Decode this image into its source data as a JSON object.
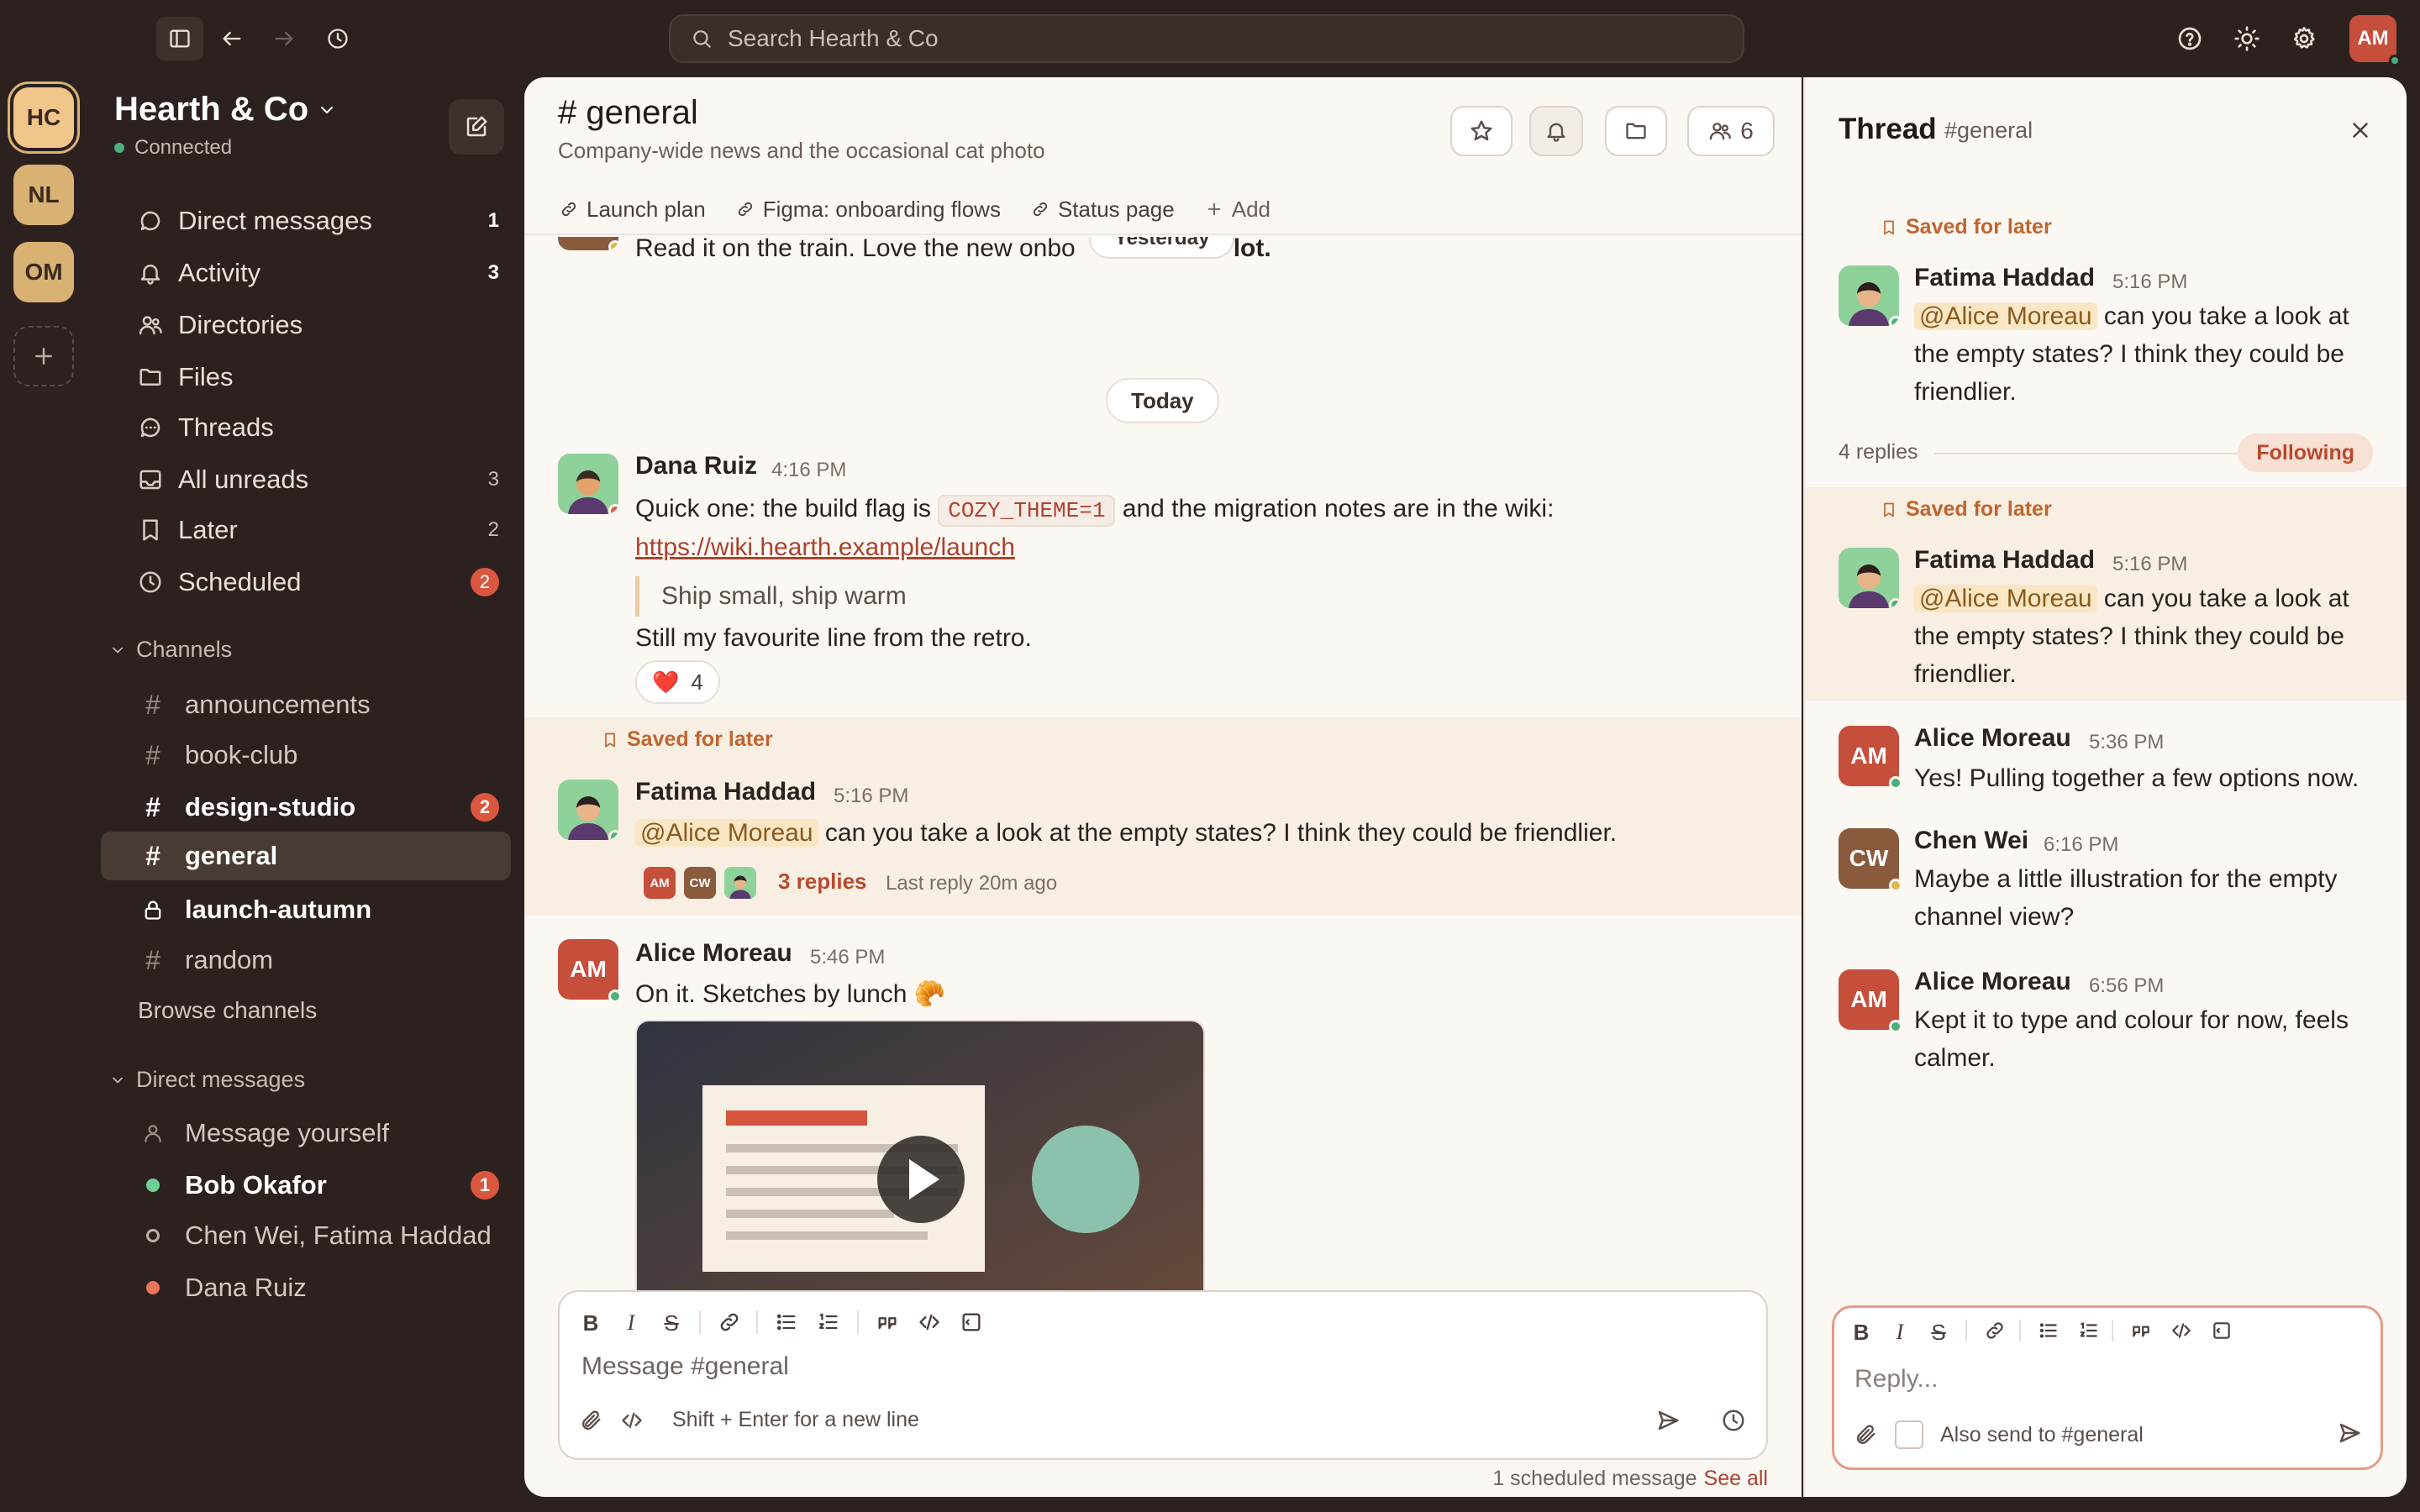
{
  "search": {
    "placeholder": "Search Hearth & Co"
  },
  "user": {
    "initials": "AM"
  },
  "workspaces": [
    {
      "initials": "HC",
      "color": "#f0c68a"
    },
    {
      "initials": "NL",
      "color": "#d9b172"
    },
    {
      "initials": "OM",
      "color": "#d9b172"
    }
  ],
  "sidebar": {
    "workspace_name": "Hearth & Co",
    "status": "Connected",
    "nav": [
      {
        "label": "Direct messages",
        "count": "1"
      },
      {
        "label": "Activity",
        "count": "3"
      },
      {
        "label": "Directories",
        "count": ""
      },
      {
        "label": "Files",
        "count": ""
      },
      {
        "label": "Threads",
        "count": ""
      },
      {
        "label": "All unreads",
        "count": "3"
      },
      {
        "label": "Later",
        "count": "2"
      },
      {
        "label": "Scheduled",
        "count": "2"
      }
    ],
    "channels_header": "Channels",
    "channels": [
      {
        "name": "announcements",
        "badge": ""
      },
      {
        "name": "book-club",
        "badge": ""
      },
      {
        "name": "design-studio",
        "badge": "2"
      },
      {
        "name": "general",
        "badge": ""
      },
      {
        "name": "launch-autumn",
        "badge": ""
      },
      {
        "name": "random",
        "badge": ""
      }
    ],
    "browse_channels": "Browse channels",
    "dms_header": "Direct messages",
    "dms": [
      {
        "name": "Message yourself",
        "badge": ""
      },
      {
        "name": "Bob Okafor",
        "badge": "1"
      },
      {
        "name": "Chen Wei, Fatima Haddad",
        "badge": ""
      },
      {
        "name": "Dana Ruiz",
        "badge": ""
      }
    ]
  },
  "channel": {
    "title": "# general",
    "description": "Company-wide news and the occasional cat photo",
    "member_count": "6",
    "bookmarks": [
      "Launch plan",
      "Figma: onboarding flows",
      "Status page",
      "Add"
    ]
  },
  "messages": {
    "prev_text_a": "Read it on the train. Love the new onbo",
    "prev_text_b": "lot.",
    "yesterday": "Yesterday",
    "today": "Today",
    "dana": {
      "name": "Dana Ruiz",
      "time": "4:16 PM",
      "text_a": "Quick one: the build flag is",
      "code": "COZY_THEME=1",
      "text_b": "and the migration notes are in the wiki:",
      "link": "https://wiki.hearth.example/launch",
      "quote": "Ship small, ship warm",
      "text_c": "Still my favourite line from the retro.",
      "reaction_emoji": "❤️",
      "reaction_count": "4"
    },
    "saved_label": "Saved for later",
    "fatima": {
      "name": "Fatima Haddad",
      "time": "5:16 PM",
      "mention": "@Alice Moreau",
      "text": "can you take a look at the empty states? I think they could be friendlier.",
      "replies": "3 replies",
      "last_reply": "Last reply 20m ago"
    },
    "alice": {
      "name": "Alice Moreau",
      "initials": "AM",
      "time": "5:46 PM",
      "text": "On it. Sketches by lunch 🥐"
    }
  },
  "composer": {
    "placeholder": "Message #general",
    "hint": "Shift + Enter for a new line",
    "scheduled": "1 scheduled message",
    "see_all": "See all"
  },
  "thread": {
    "title": "Thread",
    "channel": "#general",
    "saved_label": "Saved for later",
    "parent": {
      "name": "Fatima Haddad",
      "time": "5:16 PM",
      "mention": "@Alice Moreau",
      "text": "can you take a look at the empty states? I think they could be friendlier."
    },
    "replies_count": "4 replies",
    "following": "Following",
    "replies": [
      {
        "name": "Fatima Haddad",
        "initials": "",
        "time": "5:16 PM",
        "mention": "@Alice Moreau",
        "text": "can you take a look at the empty states? I think they could be friendlier."
      },
      {
        "name": "Alice Moreau",
        "initials": "AM",
        "time": "5:36 PM",
        "mention": "",
        "text": "Yes! Pulling together a few options now."
      },
      {
        "name": "Chen Wei",
        "initials": "CW",
        "time": "6:16 PM",
        "mention": "",
        "text": "Maybe a little illustration for the empty channel view?"
      },
      {
        "name": "Alice Moreau",
        "initials": "AM",
        "time": "6:56 PM",
        "mention": "",
        "text": "Kept it to type and colour for now, feels calmer."
      }
    ],
    "reply_placeholder": "Reply...",
    "also_send": "Also send to #general"
  },
  "colors": {
    "accent": "#c64f3c",
    "badge": "#d9573f",
    "saved": "#c0652e",
    "online": "#4caf7d"
  }
}
